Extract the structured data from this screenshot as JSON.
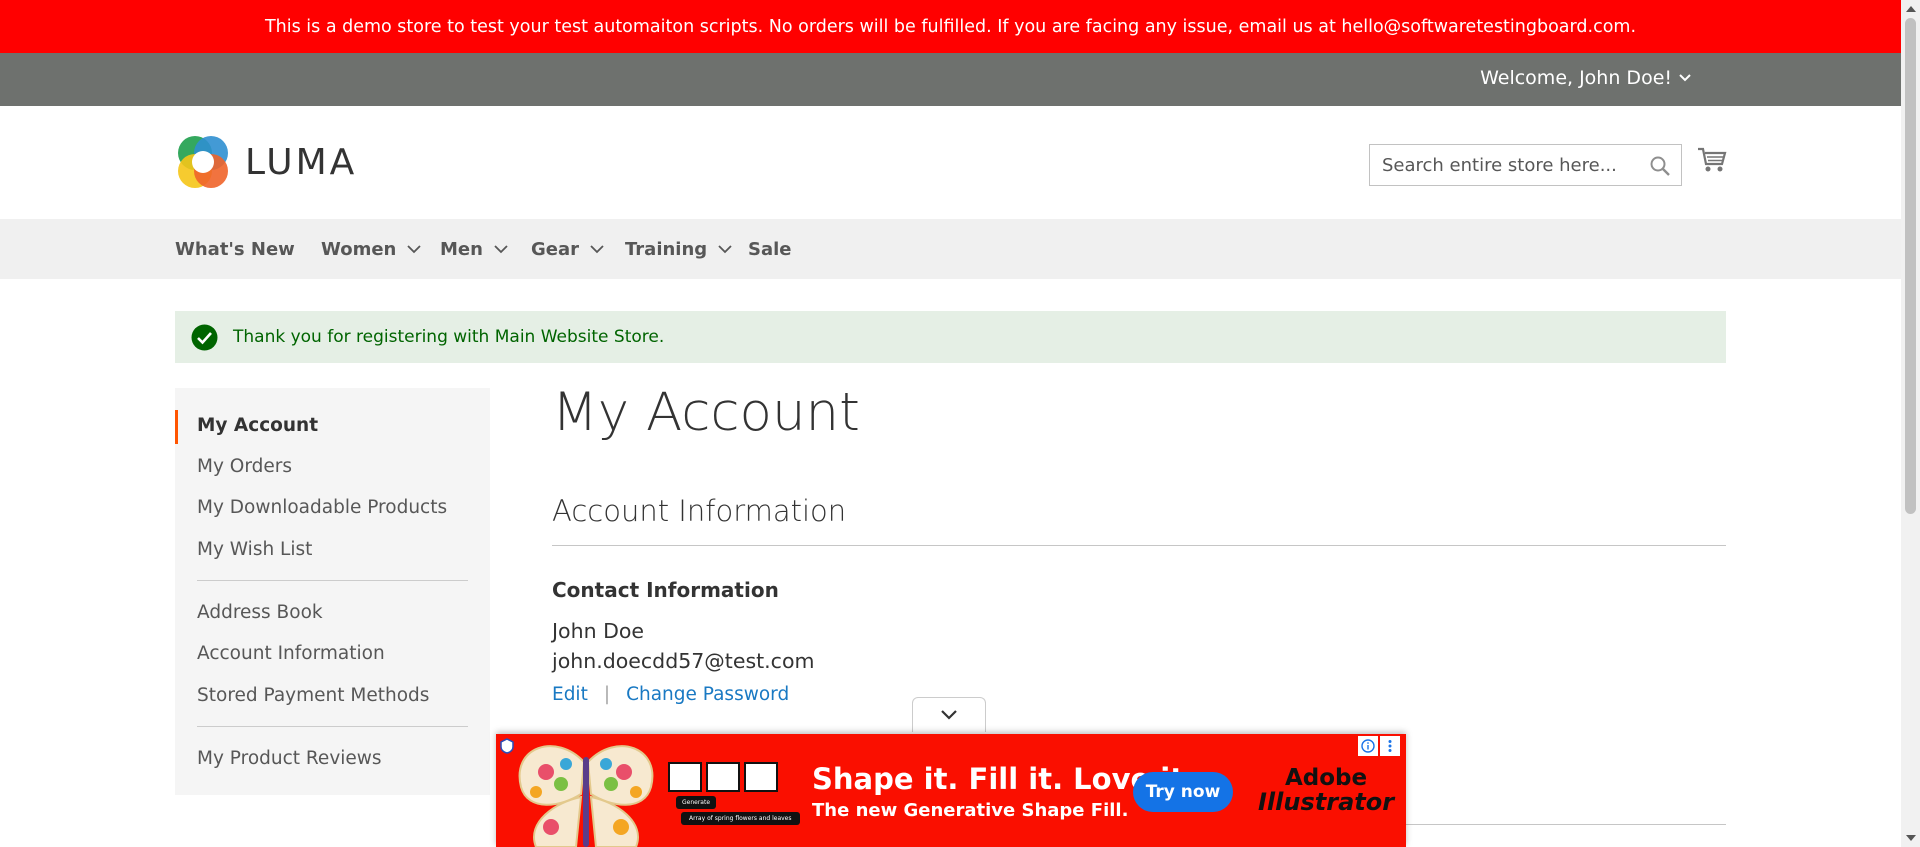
{
  "demo_notice": "This is a demo store to test your test automaiton scripts. No orders will be fulfilled. If you are facing any issue, email us at hello@softwaretestingboard.com.",
  "header": {
    "welcome": "Welcome, John Doe!",
    "logo_text": "LUMA",
    "search_placeholder": "Search entire store here..."
  },
  "nav": {
    "items": [
      {
        "label": "What's New",
        "has_dropdown": false
      },
      {
        "label": "Women",
        "has_dropdown": true
      },
      {
        "label": "Men",
        "has_dropdown": true
      },
      {
        "label": "Gear",
        "has_dropdown": true
      },
      {
        "label": "Training",
        "has_dropdown": true
      },
      {
        "label": "Sale",
        "has_dropdown": false
      }
    ]
  },
  "message": "Thank you for registering with Main Website Store.",
  "sidebar": {
    "items": [
      {
        "label": "My Account",
        "active": true
      },
      {
        "label": "My Orders"
      },
      {
        "label": "My Downloadable Products"
      },
      {
        "label": "My Wish List"
      },
      {
        "label": "Address Book"
      },
      {
        "label": "Account Information"
      },
      {
        "label": "Stored Payment Methods"
      },
      {
        "label": "My Product Reviews"
      }
    ]
  },
  "main": {
    "title": "My Account",
    "section_title": "Account Information",
    "contact": {
      "title": "Contact Information",
      "name": "John Doe",
      "email": "john.doecdd57@test.com",
      "edit_label": "Edit",
      "separator": "|",
      "change_password_label": "Change Password"
    }
  },
  "ad": {
    "headline": "Shape it. Fill it. Love it.",
    "subline": "The new Generative Shape Fill.",
    "cta": "Try now",
    "brand_line1": "Adobe",
    "brand_line2": "Illustrator",
    "tag_generate": "Generate",
    "tag_prompt": "Array of spring flowers and leaves",
    "background_color": "#fa0f00"
  },
  "colors": {
    "demo_bar": "#ff0000",
    "panel_header": "#6e716e",
    "accent": "#ff5501",
    "link": "#1979c3",
    "success_bg": "#e5efe5",
    "success_text": "#006400"
  }
}
